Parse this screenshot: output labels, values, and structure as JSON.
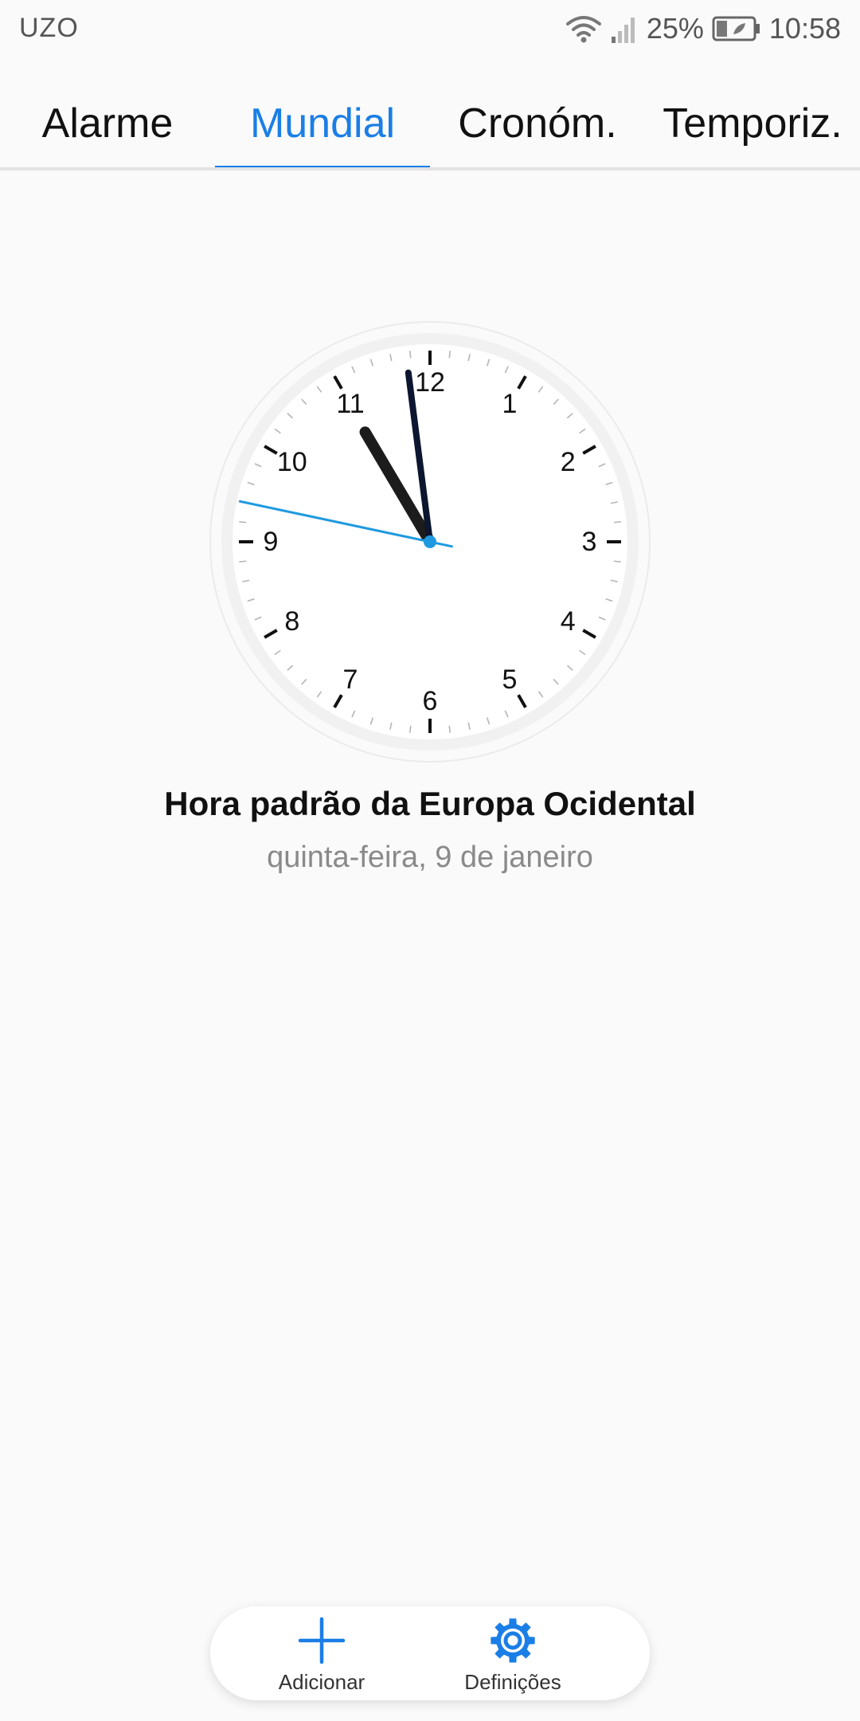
{
  "status_bar": {
    "carrier": "UZO",
    "battery": "25%",
    "time": "10:58",
    "icons": [
      "wifi-icon",
      "signal-icon",
      "battery-icon"
    ]
  },
  "tabs": [
    {
      "label": "Alarme",
      "active": false
    },
    {
      "label": "Mundial",
      "active": true
    },
    {
      "label": "Cronóm.",
      "active": false
    },
    {
      "label": "Temporiz.",
      "active": false
    }
  ],
  "clock": {
    "hour": 10,
    "minute": 58,
    "second": 47,
    "numerals": [
      "12",
      "1",
      "2",
      "3",
      "4",
      "5",
      "6",
      "7",
      "8",
      "9",
      "10",
      "11"
    ]
  },
  "zone": {
    "name": "Hora padrão da Europa Ocidental",
    "date": "quinta-feira, 9 de janeiro"
  },
  "actions": {
    "add_label": "Adicionar",
    "settings_label": "Definições"
  },
  "colors": {
    "accent": "#1a7ee6",
    "second_hand": "#1f9ae0",
    "minute_hand": "#0d1630",
    "hour_hand": "#1c1c1c"
  }
}
